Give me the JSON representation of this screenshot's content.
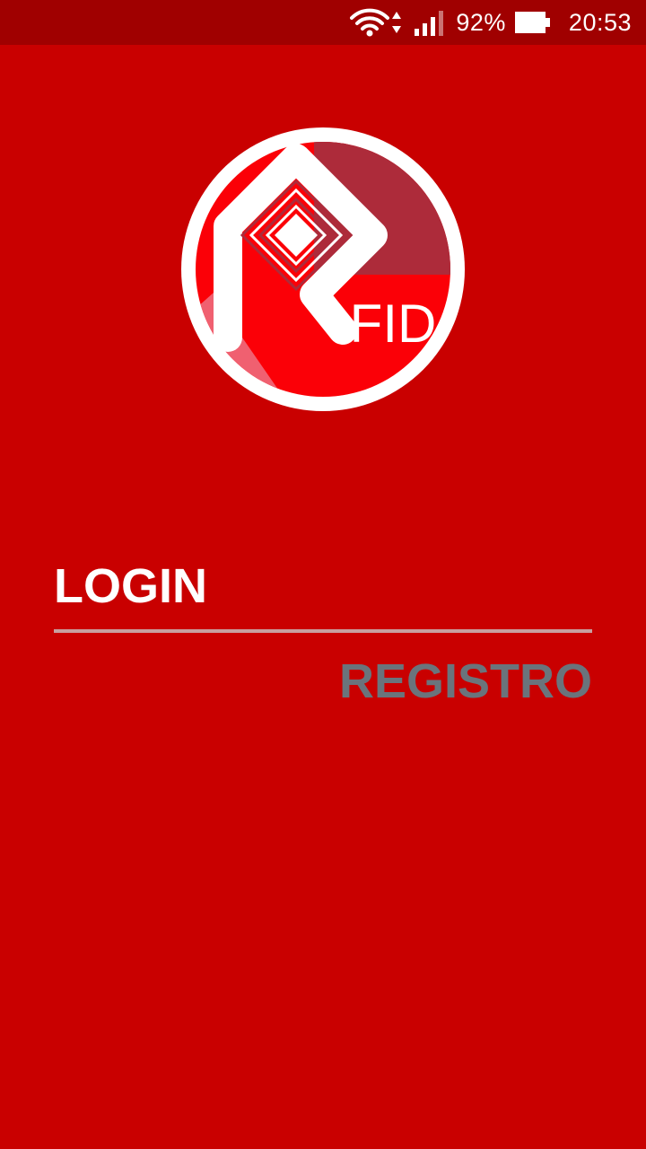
{
  "status_bar": {
    "battery_percent": "92%",
    "time": "20:53",
    "icons": [
      "wifi-icon",
      "data-transfer-icon",
      "signal-icon",
      "battery-icon"
    ]
  },
  "logo": {
    "text": "FID",
    "icon": "rfid-logo"
  },
  "tabs": {
    "login_label": "LOGIN",
    "registro_label": "REGISTRO",
    "active": "LOGIN"
  },
  "colors": {
    "background": "#c90000",
    "status_bar": "#a00000",
    "active_tab_text": "#ffffff",
    "inactive_tab_text": "#6a747c"
  }
}
